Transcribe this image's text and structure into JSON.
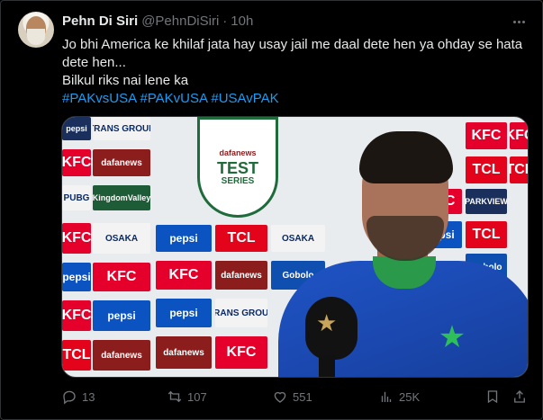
{
  "tweet": {
    "display_name": "Pehn Di Siri",
    "handle": "@PehnDiSiri",
    "separator": "·",
    "time": "10h",
    "text_line1": "Jo bhi America ke khilaf jata hay usay jail me daal dete hen ya ohday se hata dete hen...",
    "text_line2": "Bilkul riks nai lene ka",
    "hashtags": [
      "#PAKvsUSA",
      "#PAKvUSA",
      "#USAvPAK"
    ]
  },
  "media": {
    "sponsors": {
      "kfc": "KFC",
      "tcl": "TCL",
      "pepsi": "pepsi",
      "dafanews": "dafanews",
      "trans": "TRANS GROUP",
      "osaka": "OSAKA",
      "kingdom": "KingdomValley",
      "gobolo": "Gobolo",
      "pubg": "PUBG",
      "kfcgroup": "PARKVIEW"
    },
    "shield": {
      "brand": "dafanews",
      "title": "TEST",
      "subtitle": "SERIES"
    }
  },
  "actions": {
    "replies": "13",
    "reposts": "107",
    "likes": "551",
    "views": "25K"
  },
  "colors": {
    "background": "#000000",
    "text": "#e7e9ea",
    "muted": "#71767b",
    "link": "#1d9bf0",
    "border": "#2f3336"
  }
}
